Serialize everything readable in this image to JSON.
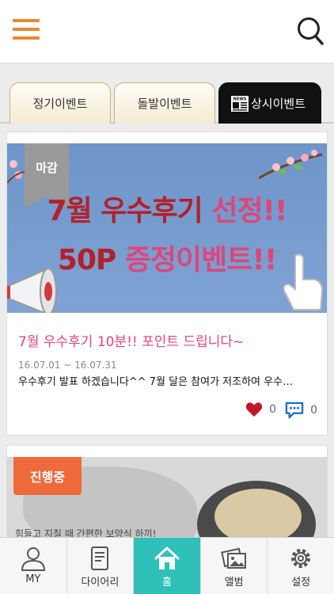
{
  "header": {
    "menu_icon": "hamburger-menu-icon",
    "search_icon": "search-icon",
    "accent_color": "#e8892f"
  },
  "tabs": [
    {
      "label": "정기이벤트",
      "active": false
    },
    {
      "label": "돌발이벤트",
      "active": false
    },
    {
      "label": "상시이벤트",
      "active": true,
      "icon": "news-icon",
      "icon_text": "NEWS"
    }
  ],
  "posts": [
    {
      "badge": "마감",
      "banner_line1_a": "7월 우수후기",
      "banner_line1_b": "선정!!",
      "banner_line2_a": "50P",
      "banner_line2_b": "증정이벤트!!",
      "title": "7월 우수후기 10분!! 포인트 드립니다~",
      "date": "16.07.01 ~ 16.07.31",
      "description": "우수후기 발표 하겠습니다^^ 7월 달은 참여가 저조하여 우수…",
      "likes": "0",
      "comments": "0"
    },
    {
      "badge": "진행중",
      "banner_text": "힘들고 지칠 때 간편한 보양식 하끼!"
    }
  ],
  "bottom_nav": [
    {
      "label": "MY",
      "icon": "person-icon",
      "active": false
    },
    {
      "label": "다이어리",
      "icon": "diary-icon",
      "active": false
    },
    {
      "label": "홈",
      "icon": "home-icon",
      "active": true
    },
    {
      "label": "앨범",
      "icon": "album-icon",
      "active": false
    },
    {
      "label": "설정",
      "icon": "gear-icon",
      "active": false
    }
  ],
  "colors": {
    "title_pink": "#e0457a",
    "nav_active": "#2fc0ba",
    "badge_orange": "#ee6a3b",
    "like_red": "#c0182a",
    "comment_blue": "#1a6fc4"
  }
}
